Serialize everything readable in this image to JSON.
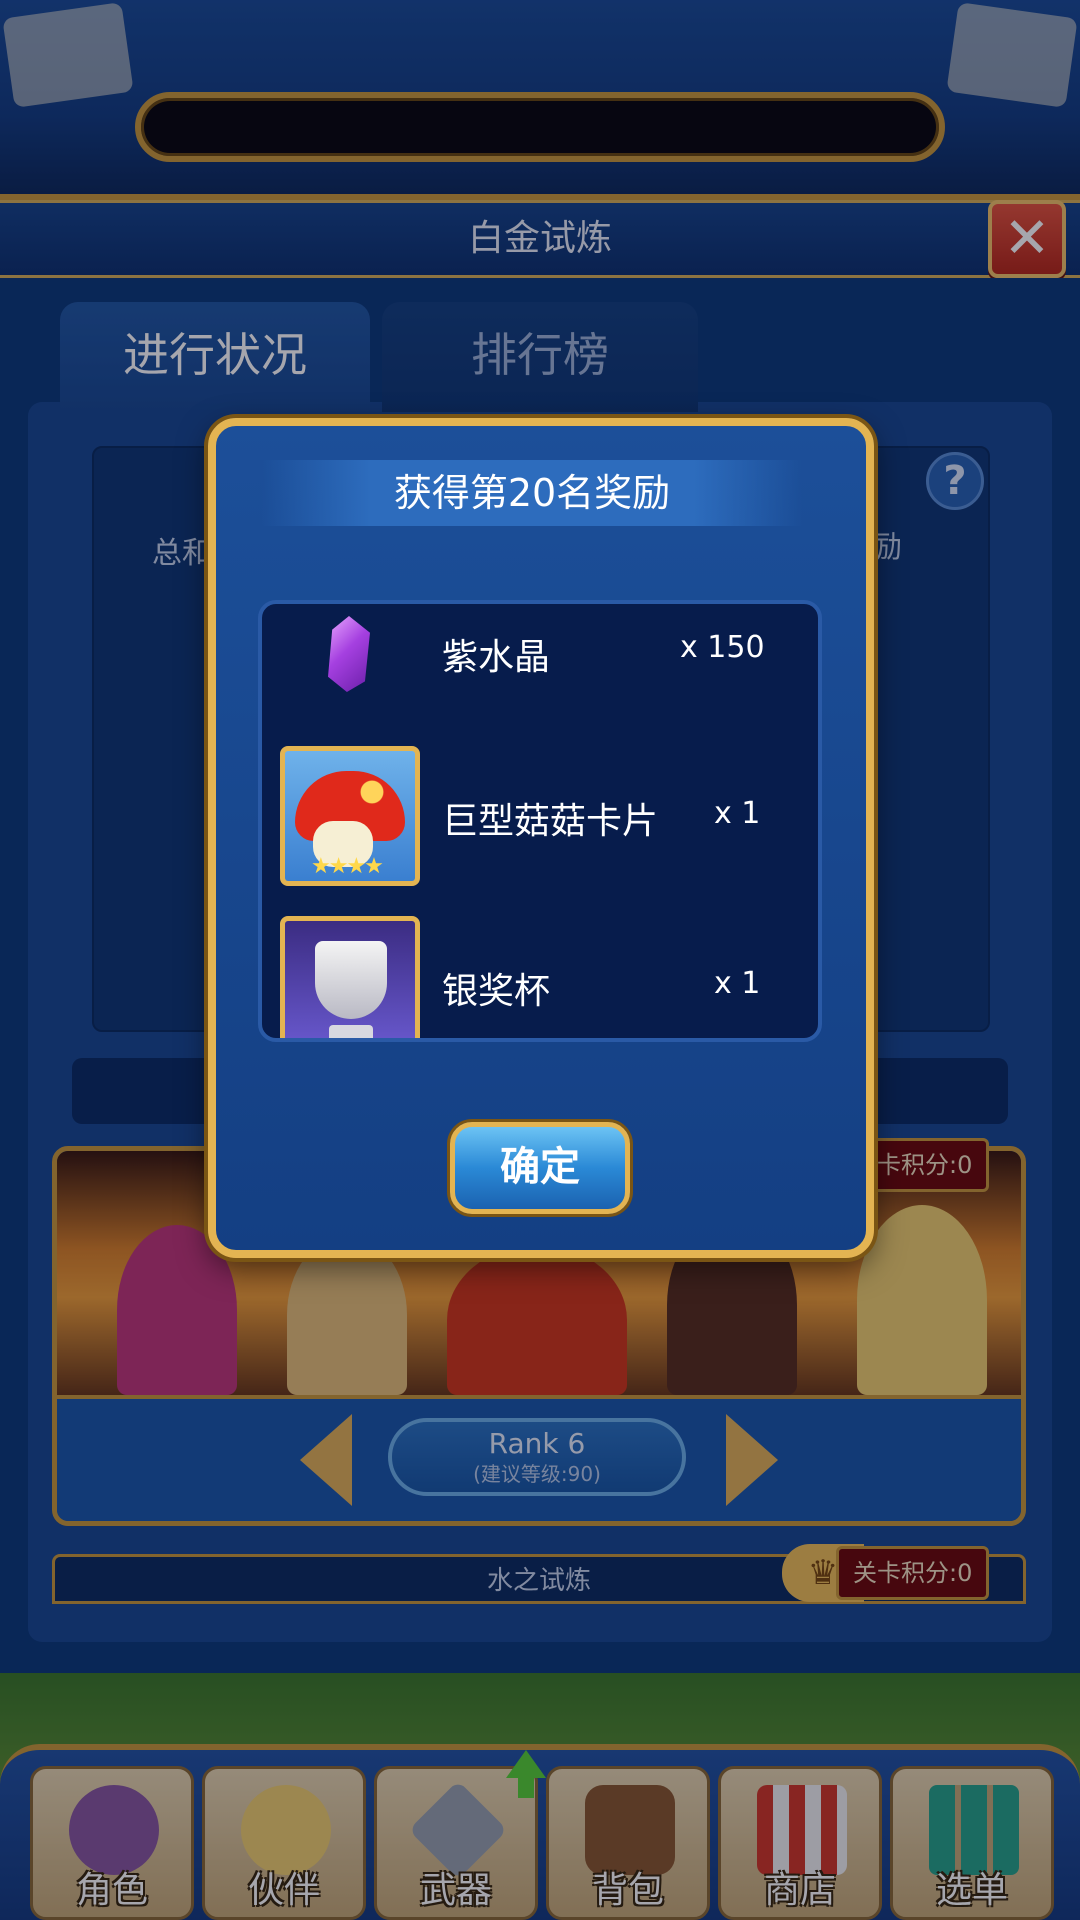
{
  "window": {
    "title": "白金试炼"
  },
  "tabs": [
    {
      "label": "进行状况",
      "active": true
    },
    {
      "label": "排行榜",
      "active": false
    }
  ],
  "background": {
    "total_label_partial": "总和",
    "reward_label_partial": "励",
    "stage": {
      "rank_title": "Rank 6",
      "rank_sub": "(建议等级:90)",
      "score_label": "卡积分:0"
    },
    "next_stage": {
      "title": "水之试炼",
      "score_label": "关卡积分:0"
    }
  },
  "modal": {
    "title": "获得第20名奖励",
    "rewards": [
      {
        "name": "紫水晶",
        "quantity": "x 150",
        "icon": "purple-crystal-icon"
      },
      {
        "name": "巨型菇菇卡片",
        "quantity": "x 1",
        "icon": "giant-mushroom-card-icon"
      },
      {
        "name": "银奖杯",
        "quantity": "x 1",
        "icon": "silver-trophy-icon"
      }
    ],
    "confirm_label": "确定"
  },
  "bottom_nav": [
    {
      "label": "角色",
      "icon": "character-icon"
    },
    {
      "label": "伙伴",
      "icon": "partner-icon"
    },
    {
      "label": "武器",
      "icon": "weapon-icon"
    },
    {
      "label": "背包",
      "icon": "bag-icon"
    },
    {
      "label": "商店",
      "icon": "shop-icon"
    },
    {
      "label": "选单",
      "icon": "menu-grid-icon"
    }
  ],
  "colors": {
    "gold_border": "#c99a3c",
    "panel_blue": "#1b4b92",
    "close_red": "#d03a28",
    "score_red": "#6e0c0c"
  }
}
